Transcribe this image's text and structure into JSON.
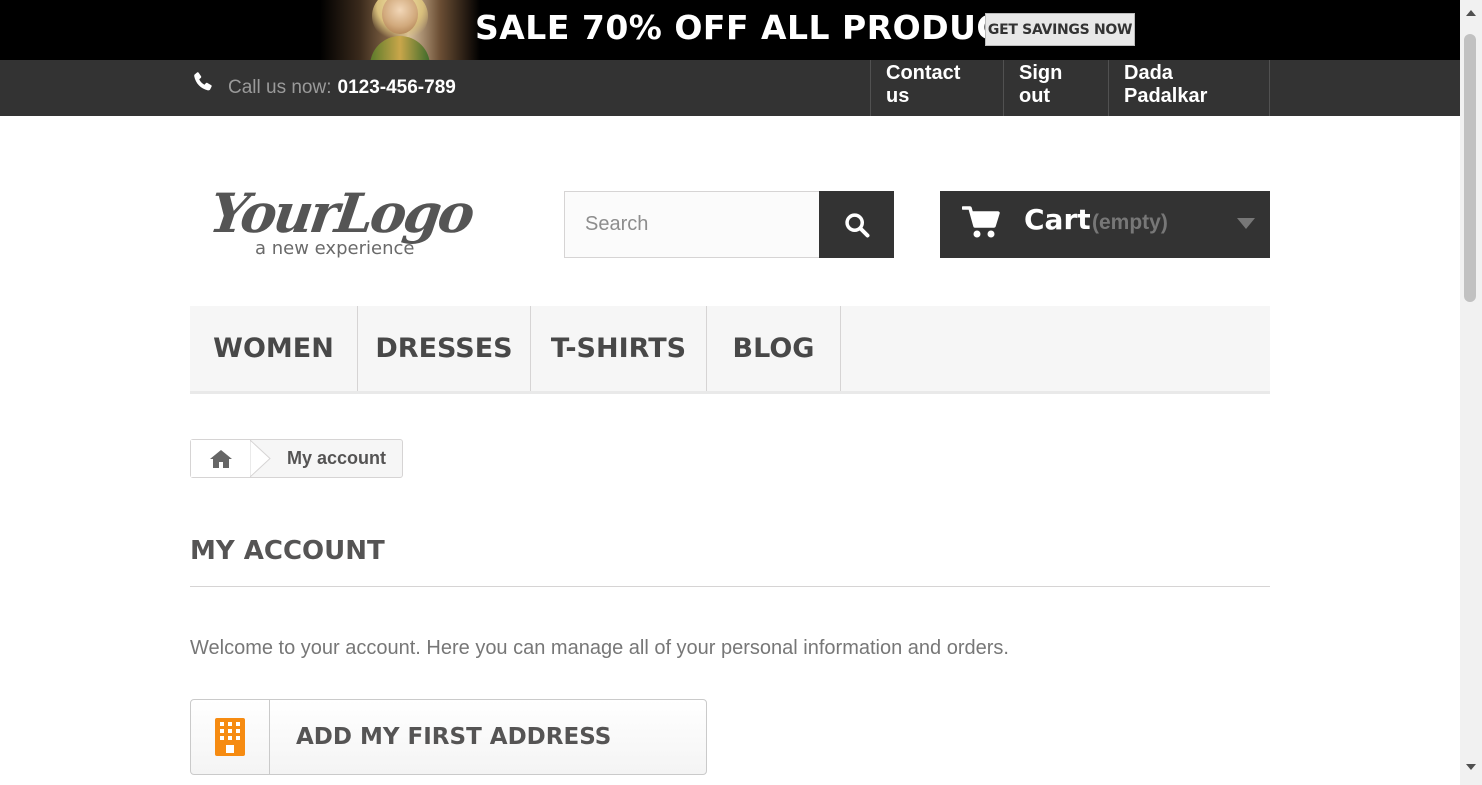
{
  "banner": {
    "text": "SALE 70% OFF ALL PRODUCTS",
    "button_label": "GET SAVINGS NOW"
  },
  "topbar": {
    "call_label": "Call us now:",
    "phone": "0123-456-789",
    "links": [
      "Contact us",
      "Sign out",
      "Dada Padalkar"
    ]
  },
  "header": {
    "logo_text": "YourLogo",
    "logo_tagline": "a new experience",
    "search_placeholder": "Search",
    "search_value": "",
    "cart_label": "Cart",
    "cart_status": "(empty)"
  },
  "menu": {
    "items": [
      "WOMEN",
      "DRESSES",
      "T-SHIRTS",
      "BLOG"
    ]
  },
  "breadcrumb": {
    "current": "My account"
  },
  "account": {
    "heading": "MY ACCOUNT",
    "info": "Welcome to your account. Here you can manage all of your personal information and orders.",
    "address_button": "ADD MY FIRST ADDRESS"
  },
  "colors": {
    "dark_bar": "#333333",
    "accent_orange": "#f68b11",
    "text_gray": "#777777",
    "heading_gray": "#555454"
  },
  "icons": {
    "phone": "phone-icon",
    "search": "search-icon",
    "cart": "cart-icon",
    "cart_caret": "caret-down-icon",
    "home": "home-icon",
    "address": "building-icon"
  }
}
